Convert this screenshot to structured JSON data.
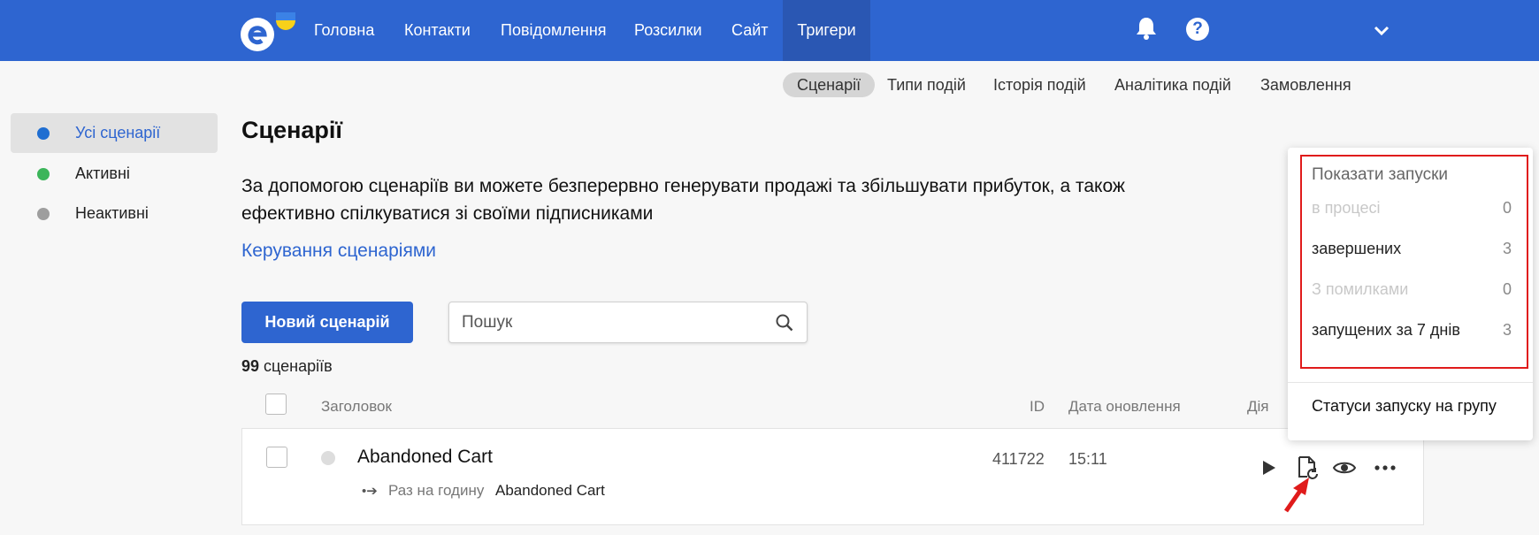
{
  "nav": {
    "items": [
      {
        "label": "Головна"
      },
      {
        "label": "Контакти"
      },
      {
        "label": "Повідомлення"
      },
      {
        "label": "Розсилки"
      },
      {
        "label": "Сайт"
      },
      {
        "label": "Тригери"
      }
    ],
    "active": "Тригери",
    "bell_icon": "bell-icon",
    "help_label": "?",
    "account_icon": "chevron-down-icon"
  },
  "subnav": {
    "items": [
      {
        "label": "Сценарії"
      },
      {
        "label": "Типи подій"
      },
      {
        "label": "Історія подій"
      },
      {
        "label": "Аналітика подій"
      },
      {
        "label": "Замовлення"
      }
    ],
    "active": "Сценарії"
  },
  "sidebar": {
    "items": [
      {
        "label": "Усі сценарії",
        "dot_color": "#1f6ed1"
      },
      {
        "label": "Активні",
        "dot_color": "#3cb55a"
      },
      {
        "label": "Неактивні",
        "dot_color": "#9e9e9e"
      }
    ]
  },
  "main": {
    "title": "Сценарії",
    "description": "За допомогою сценаріїв ви можете безперервно генерувати продажі та збільшувати прибуток, а також ефективно спілкуватися зі своїми підписниками",
    "manage_link": "Керування сценаріями",
    "new_button": "Новий сценарій",
    "search_placeholder": "Пошук",
    "count_number": "99",
    "count_label": "сценаріїв"
  },
  "table": {
    "headers": {
      "title": "Заголовок",
      "id": "ID",
      "updated": "Дата оновлення",
      "action": "Дія"
    },
    "rows": [
      {
        "title": "Abandoned Cart",
        "frequency": "Раз на годину",
        "event": "Abandoned Cart",
        "id": "411722",
        "updated": "15:11"
      }
    ]
  },
  "dropdown": {
    "heading": "Показати запуски",
    "items": [
      {
        "label": "в процесі",
        "count": "0",
        "enabled": false
      },
      {
        "label": "завершених",
        "count": "3",
        "enabled": true
      },
      {
        "label": "З помилками",
        "count": "0",
        "enabled": false
      },
      {
        "label": "запущених за 7 днів",
        "count": "3",
        "enabled": true
      }
    ],
    "group_status": "Статуси запуску на групу"
  },
  "colors": {
    "brand": "#2e65d0",
    "highlight": "#e01b1b"
  }
}
